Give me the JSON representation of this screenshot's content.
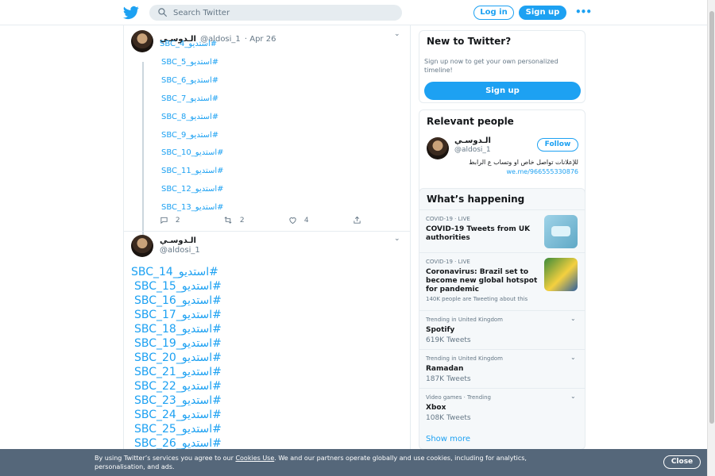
{
  "header": {
    "search_placeholder": "Search Twitter",
    "login_label": "Log in",
    "signup_label": "Sign up",
    "more_label": "•••"
  },
  "tweet1": {
    "name": "الـدوسـي",
    "handle": "@aldosi_1",
    "date": "· Apr 26",
    "links": [
      "SBC_4_استديو#",
      "SBC_5_استديو#",
      "SBC_6_استديو#",
      "SBC_7_استديو#",
      "SBC_8_استديو#",
      "SBC_9_استديو#",
      "SBC_10_استديو#",
      "SBC_11_استديو#",
      "SBC_12_استديو#",
      "SBC_13_استديو#"
    ],
    "reply_count": "2",
    "retweet_count": "2",
    "like_count": "4"
  },
  "tweet2": {
    "name": "الـدوسـي",
    "handle": "@aldosi_1",
    "links": [
      "SBC_14_استديو#",
      "SBC_15_استديو#",
      "SBC_16_استديو#",
      "SBC_17_استديو#",
      "SBC_18_استديو#",
      "SBC_19_استديو#",
      "SBC_20_استديو#",
      "SBC_21_استديو#",
      "SBC_22_استديو#",
      "SBC_23_استديو#",
      "SBC_24_استديو#",
      "SBC_25_استديو#",
      "SBC_26_استديو#"
    ]
  },
  "new_to_twitter": {
    "title": "New to Twitter?",
    "subtitle": "Sign up now to get your own personalized timeline!",
    "button": "Sign up"
  },
  "relevant_people": {
    "title": "Relevant people",
    "name": "الـدوسـي",
    "handle": "@aldosi_1",
    "follow_label": "Follow",
    "bio": "للإعلانات تواصل خاص او وتساب ع الرابط",
    "bio_link": "we.me/966555330876"
  },
  "whats_happening": {
    "title": "What’s happening",
    "trends": [
      {
        "meta": "COVID-19 · LIVE",
        "title": "COVID-19 Tweets from UK authorities",
        "count": ""
      },
      {
        "meta": "COVID-19 · LIVE",
        "title": "Coronavirus: Brazil set to become new global hotspot for pandemic",
        "count": "140K people are Tweeting about this"
      },
      {
        "meta": "Trending in United Kingdom",
        "title": "Spotify",
        "count": "619K Tweets"
      },
      {
        "meta": "Trending in United Kingdom",
        "title": "Ramadan",
        "count": "187K Tweets"
      },
      {
        "meta": "Video games · Trending",
        "title": "Xbox",
        "count": "108K Tweets"
      }
    ],
    "show_more": "Show more"
  },
  "cookie": {
    "text_before": "By using Twitter’s services you agree to our ",
    "link": "Cookies Use",
    "text_after": ". We and our partners operate globally and use cookies, including for analytics, personalisation, and ads.",
    "close_label": "Close"
  },
  "colors": {
    "accent": "#1da1f2",
    "banner": "#55677a"
  }
}
